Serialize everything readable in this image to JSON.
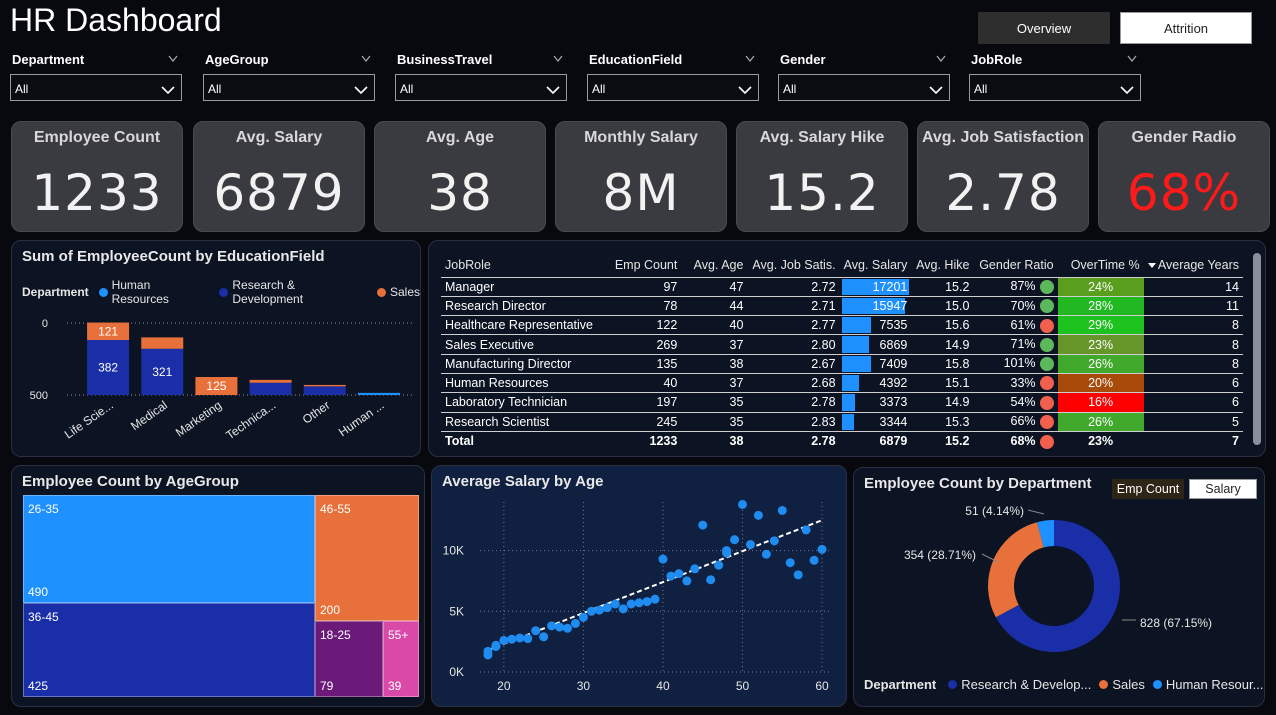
{
  "header": {
    "title": "HR Dashboard"
  },
  "tabs": [
    {
      "label": "Overview"
    },
    {
      "label": "Attrition"
    }
  ],
  "filters": [
    {
      "label": "Department",
      "value": "All"
    },
    {
      "label": "AgeGroup",
      "value": "All"
    },
    {
      "label": "BusinessTravel",
      "value": "All"
    },
    {
      "label": "EducationField",
      "value": "All"
    },
    {
      "label": "Gender",
      "value": "All"
    },
    {
      "label": "JobRole",
      "value": "All"
    }
  ],
  "kpis": [
    {
      "label": "Employee Count",
      "value": "1233",
      "color": "#f2f2f2"
    },
    {
      "label": "Avg. Salary",
      "value": "6879",
      "color": "#f2f2f2"
    },
    {
      "label": "Avg. Age",
      "value": "38",
      "color": "#f2f2f2"
    },
    {
      "label": "Monthly Salary",
      "value": "8M",
      "color": "#f2f2f2"
    },
    {
      "label": "Avg. Salary Hike",
      "value": "15.2",
      "color": "#f2f2f2"
    },
    {
      "label": "Avg. Job Satisfaction",
      "value": "2.78",
      "color": "#f2f2f2"
    },
    {
      "label": "Gender Radio",
      "value": "68%",
      "color": "#ff1a1a"
    }
  ],
  "colors": {
    "human_resources": "#1e90ff",
    "research_development": "#1a2ea8",
    "sales": "#e8703a",
    "good": "#5cb85c",
    "bad": "#f0604d"
  },
  "edu_chart": {
    "title": "Sum of EmployeeCount by EducationField",
    "legend_title": "Department",
    "ytick_labels": [
      "500",
      "0"
    ]
  },
  "chart_data": [
    {
      "type": "bar",
      "title": "Sum of EmployeeCount by EducationField",
      "categories": [
        "Life Scie...",
        "Medical",
        "Marketing",
        "Technica...",
        "Other",
        "Human ..."
      ],
      "stacked": true,
      "series": [
        {
          "name": "Human Resources",
          "values": [
            0,
            0,
            0,
            0,
            0,
            15
          ]
        },
        {
          "name": "Research & Development",
          "values": [
            382,
            321,
            0,
            85,
            60,
            0
          ]
        },
        {
          "name": "Sales",
          "values": [
            121,
            79,
            125,
            20,
            10,
            0
          ]
        }
      ],
      "data_labels": [
        "121",
        "382",
        "321",
        "125"
      ],
      "yticks": [
        0,
        500
      ],
      "ylim": [
        0,
        560
      ],
      "legend": "top-left",
      "grid": true
    },
    {
      "type": "scatter",
      "title": "Average Salary by Age",
      "xlim": [
        17,
        61
      ],
      "ylim": [
        0,
        14000
      ],
      "xticks": [
        20,
        30,
        40,
        50,
        60
      ],
      "yticks": [
        0,
        5000,
        10000
      ],
      "ytick_labels": [
        "0K",
        "5K",
        "10K"
      ],
      "x": [
        18,
        19,
        20,
        21,
        22,
        23,
        24,
        25,
        26,
        27,
        28,
        29,
        30,
        31,
        32,
        33,
        34,
        35,
        36,
        37,
        38,
        39,
        40,
        41,
        42,
        43,
        44,
        45,
        46,
        47,
        48,
        49,
        50,
        51,
        52,
        53,
        54,
        55,
        56,
        57,
        58,
        59,
        60,
        18,
        19,
        48
      ],
      "y": [
        1400,
        2100,
        2600,
        2700,
        2800,
        2750,
        3400,
        2900,
        3800,
        3700,
        3600,
        4000,
        4500,
        5000,
        5100,
        5300,
        5600,
        5200,
        5600,
        5700,
        5800,
        6000,
        9300,
        7900,
        8100,
        7500,
        8500,
        12100,
        7600,
        8800,
        9800,
        10900,
        13800,
        10500,
        12900,
        9700,
        10800,
        13300,
        9000,
        8000,
        11700,
        9200,
        10100,
        1700,
        2200,
        10000
      ],
      "trendline": {
        "x": [
          18,
          60
        ],
        "y": [
          1800,
          12500
        ]
      },
      "grid": true
    },
    {
      "type": "pie",
      "title": "Employee Count by Department",
      "donut": true,
      "labels": [
        "Research & Development",
        "Sales",
        "Human Resources"
      ],
      "values": [
        828,
        354,
        51
      ],
      "data_labels": [
        "828 (67.15%)",
        "354 (28.71%)",
        "51 (4.14%)"
      ],
      "legend": "bottom"
    },
    {
      "type": "treemap",
      "title": "Employee Count by AgeGroup",
      "labels": [
        "26-35",
        "36-45",
        "46-55",
        "18-25",
        "55+"
      ],
      "values": [
        490,
        425,
        200,
        79,
        39
      ]
    }
  ],
  "table": {
    "headers": [
      "JobRole",
      "Emp Count",
      "Avg. Age",
      "Avg. Job Satis.",
      "Avg. Salary",
      "Avg. Hike",
      "Gender Ratio",
      "OverTime %",
      "Average Years"
    ],
    "rows": [
      {
        "role": "Manager",
        "count": "97",
        "age": "47",
        "satis": "2.72",
        "salary": "17201",
        "salary_frac": 1.0,
        "hike": "15.2",
        "gender": "87%",
        "gender_ok": true,
        "ot": "24%",
        "ot_color": "#5a9e1e",
        "years": "14"
      },
      {
        "role": "Research Director",
        "count": "78",
        "age": "44",
        "satis": "2.71",
        "salary": "15947",
        "salary_frac": 0.93,
        "hike": "15.0",
        "gender": "70%",
        "gender_ok": true,
        "ot": "28%",
        "ot_color": "#22b822",
        "years": "11"
      },
      {
        "role": "Healthcare Representative",
        "count": "122",
        "age": "40",
        "satis": "2.77",
        "salary": "7535",
        "salary_frac": 0.44,
        "hike": "15.6",
        "gender": "61%",
        "gender_ok": false,
        "ot": "29%",
        "ot_color": "#1ec21e",
        "years": "8"
      },
      {
        "role": "Sales Executive",
        "count": "269",
        "age": "37",
        "satis": "2.80",
        "salary": "6869",
        "salary_frac": 0.4,
        "hike": "14.9",
        "gender": "71%",
        "gender_ok": true,
        "ot": "23%",
        "ot_color": "#66962a",
        "years": "8"
      },
      {
        "role": "Manufacturing Director",
        "count": "135",
        "age": "38",
        "satis": "2.67",
        "salary": "7409",
        "salary_frac": 0.43,
        "hike": "15.8",
        "gender": "101%",
        "gender_ok": true,
        "ot": "26%",
        "ot_color": "#40a82a",
        "years": "8"
      },
      {
        "role": "Human Resources",
        "count": "40",
        "age": "37",
        "satis": "2.68",
        "salary": "4392",
        "salary_frac": 0.26,
        "hike": "15.1",
        "gender": "33%",
        "gender_ok": false,
        "ot": "20%",
        "ot_color": "#a84a0a",
        "years": "6"
      },
      {
        "role": "Laboratory Technician",
        "count": "197",
        "age": "35",
        "satis": "2.78",
        "salary": "3373",
        "salary_frac": 0.2,
        "hike": "14.9",
        "gender": "54%",
        "gender_ok": false,
        "ot": "16%",
        "ot_color": "#ff0000",
        "years": "6"
      },
      {
        "role": "Research Scientist",
        "count": "245",
        "age": "35",
        "satis": "2.83",
        "salary": "3344",
        "salary_frac": 0.19,
        "hike": "15.3",
        "gender": "66%",
        "gender_ok": false,
        "ot": "26%",
        "ot_color": "#40a82a",
        "years": "5"
      }
    ],
    "total": {
      "role": "Total",
      "count": "1233",
      "age": "38",
      "satis": "2.78",
      "salary": "6879",
      "hike": "15.2",
      "gender": "68%",
      "gender_ok": false,
      "ot": "23%",
      "years": "7"
    }
  },
  "agegroup": {
    "title": "Employee Count by AgeGroup"
  },
  "salary_age": {
    "title": "Average Salary by Age"
  },
  "department": {
    "title": "Employee Count by Department",
    "btn_emp": "Emp Count",
    "btn_salary": "Salary",
    "legend_title": "Department",
    "legend": [
      "Research & Develop...",
      "Sales",
      "Human Resour..."
    ]
  }
}
